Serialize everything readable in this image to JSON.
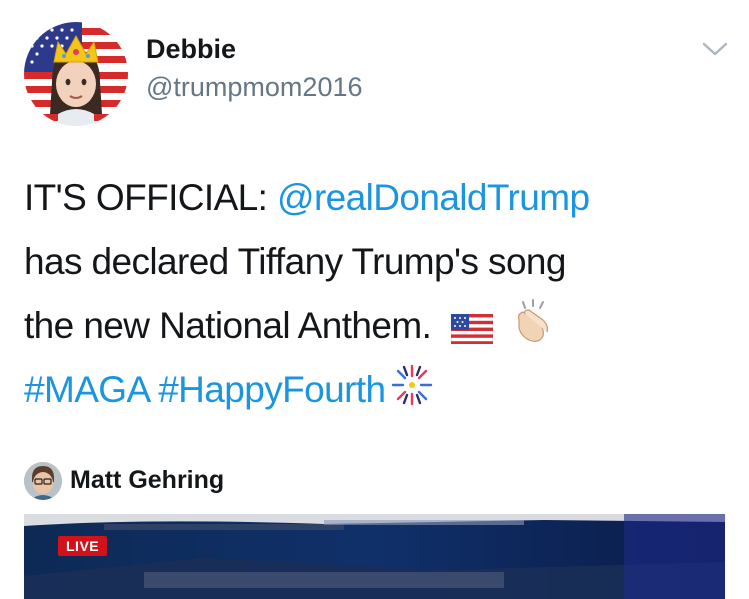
{
  "tweet": {
    "author": {
      "display_name": "Debbie",
      "handle": "@trumpmom2016",
      "avatar_icon": "princess-emoji-flag-avatar"
    },
    "menu_icon": "chevron-down-icon",
    "text_lines": [
      [
        "IT'S OFFICIAL: ",
        "@realDonaldTrump"
      ],
      [
        "has declared Tiffany Trump's song"
      ],
      [
        "the new National Anthem."
      ]
    ],
    "mention": "@realDonaldTrump",
    "hashtags": [
      "#MAGA",
      "#HappyFourth"
    ],
    "emojis": [
      "us-flag-emoji",
      "clapping-hands-emoji",
      "fireworks-emoji"
    ]
  },
  "quoted": {
    "author_name": "Matt Gehring",
    "avatar_icon": "user-avatar",
    "media": {
      "badge": "LIVE",
      "type": "video-thumbnail"
    }
  },
  "colors": {
    "link": "#1b95e0",
    "text": "#14171a",
    "secondary": "#657786",
    "live": "#d0121b"
  }
}
